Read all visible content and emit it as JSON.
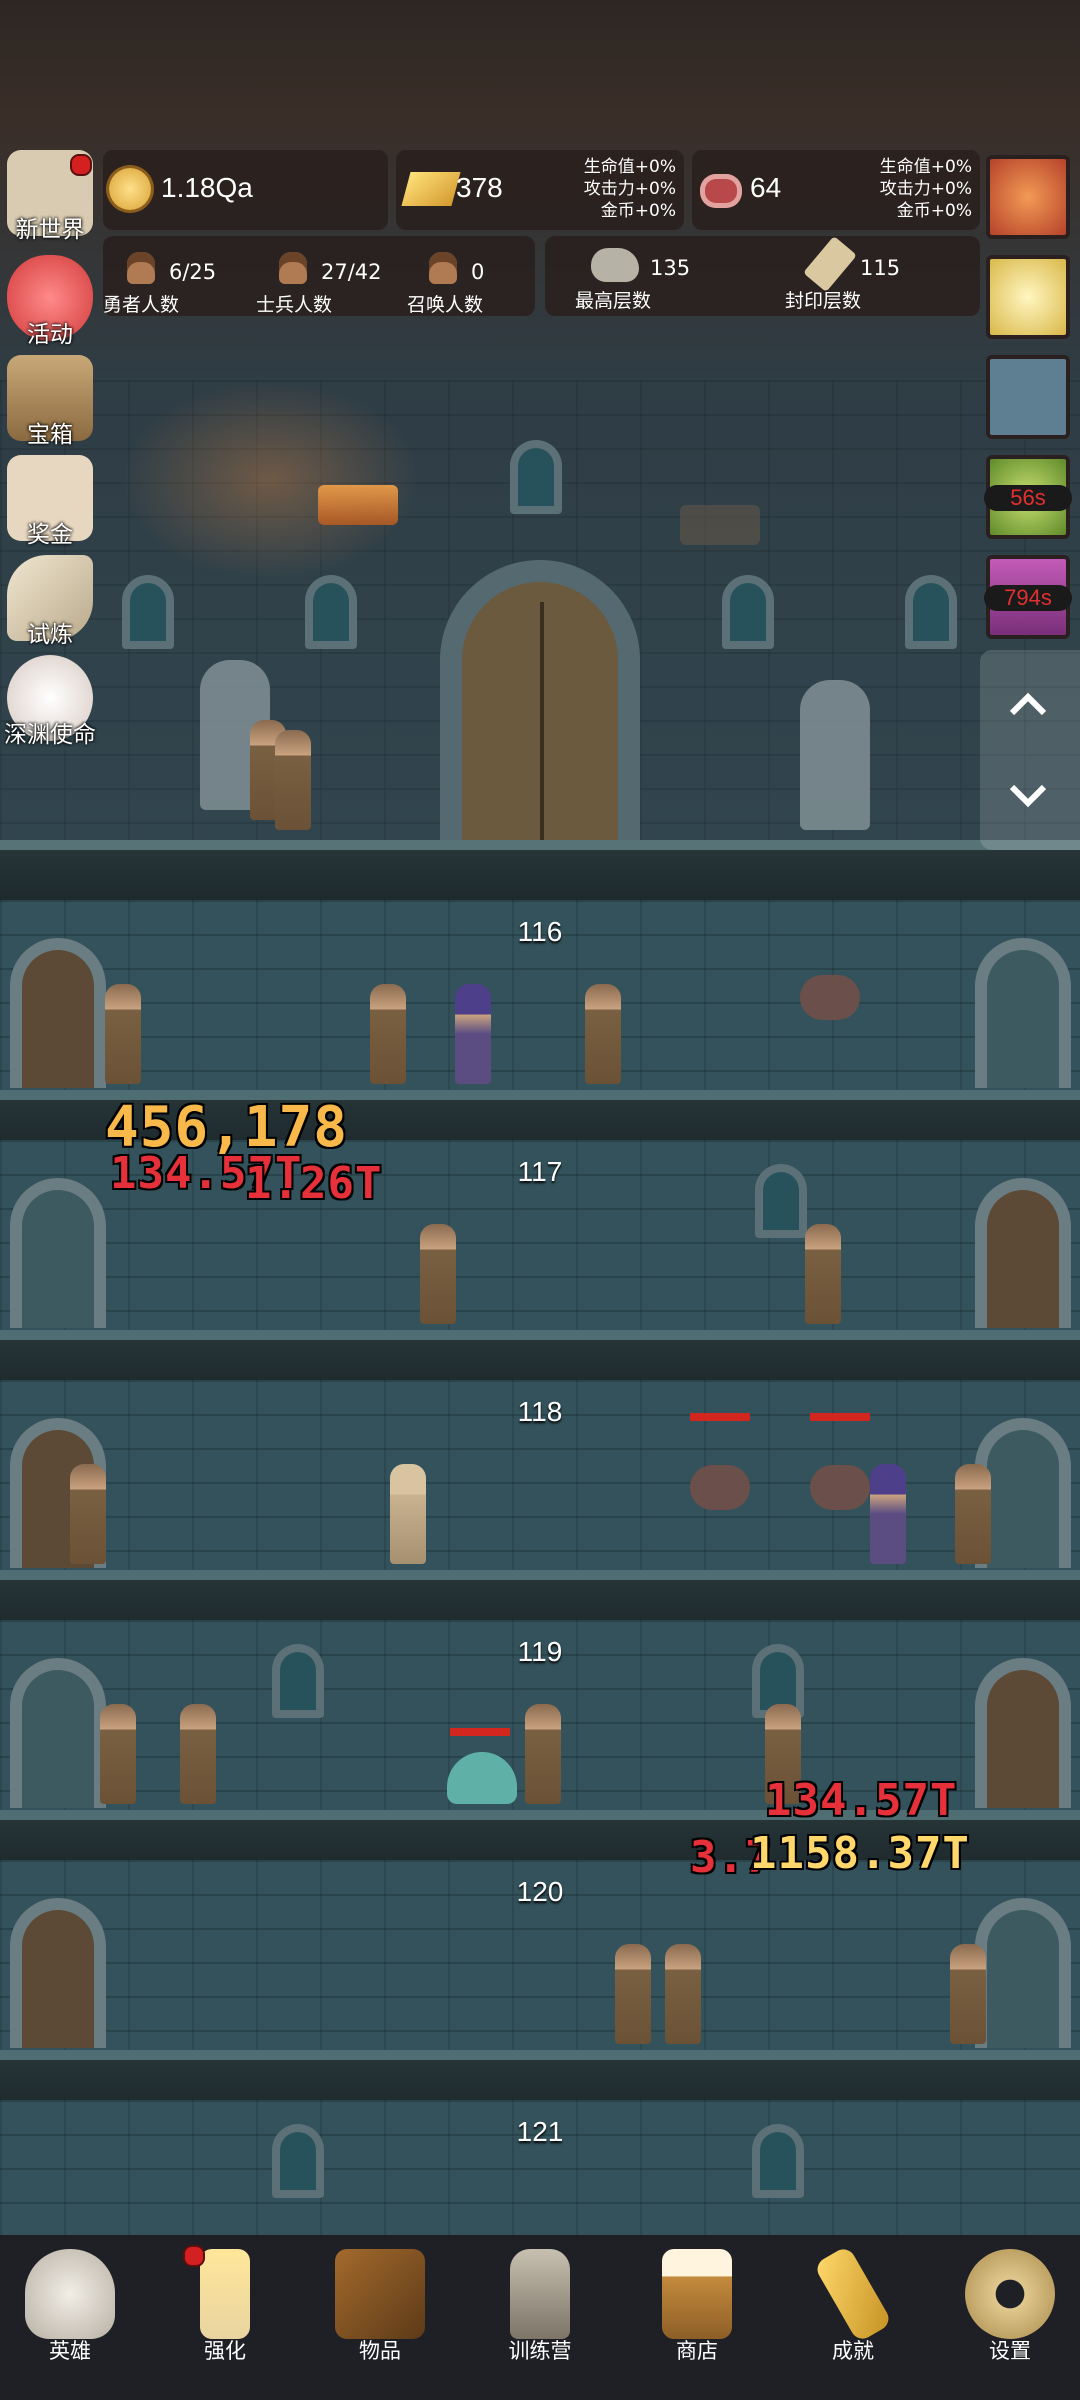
{
  "hud": {
    "coins": "1.18Qa",
    "gold_bars": "378",
    "gold_bonus": [
      "生命值+0%",
      "攻击力+0%",
      "金币+0%"
    ],
    "meat": "64",
    "meat_bonus": [
      "生命值+0%",
      "攻击力+0%",
      "金币+0%"
    ],
    "hero_count": {
      "value": "6/25",
      "label": "勇者人数"
    },
    "soldier_count": {
      "value": "27/42",
      "label": "士兵人数"
    },
    "summon_count": {
      "value": "0",
      "label": "召唤人数"
    },
    "max_floor": {
      "value": "135",
      "label": "最高层数"
    },
    "sealed_floor": {
      "value": "115",
      "label": "封印层数"
    }
  },
  "left_menu": [
    {
      "label": "新世界",
      "icon": "map-icon",
      "badge": true
    },
    {
      "label": "活动",
      "icon": "heart-icon",
      "badge": false
    },
    {
      "label": "宝箱",
      "icon": "chest-icon",
      "badge": false
    },
    {
      "label": "奖金",
      "icon": "envelope-icon",
      "badge": false
    },
    {
      "label": "试炼",
      "icon": "feather-icon",
      "badge": false
    },
    {
      "label": "深渊使命",
      "icon": "orb-icon",
      "badge": false
    }
  ],
  "right_menu": [
    {
      "icon": "apple-icon",
      "timer": ""
    },
    {
      "icon": "candle-icon",
      "timer": ""
    },
    {
      "icon": "scroll-bag-icon",
      "timer": ""
    },
    {
      "icon": "green-orb-icon",
      "timer": "56s"
    },
    {
      "icon": "purple-chest-icon",
      "timer": "794s"
    }
  ],
  "floors": [
    "116",
    "117",
    "118",
    "119",
    "120",
    "121"
  ],
  "damage_texts": [
    {
      "text": "456,178",
      "style": "gold"
    },
    {
      "text": "134.57T",
      "style": "red"
    },
    {
      "text": "1.26T",
      "style": "red"
    },
    {
      "text": "134.57T",
      "style": "red"
    },
    {
      "text": "3.7",
      "style": "red"
    },
    {
      "text": "1158.37T",
      "style": "red"
    }
  ],
  "nav": [
    {
      "label": "英雄",
      "icon": "skull-icon",
      "badge": false
    },
    {
      "label": "强化",
      "icon": "candle-icon",
      "badge": true
    },
    {
      "label": "物品",
      "icon": "book-icon",
      "badge": false
    },
    {
      "label": "训练营",
      "icon": "lantern-icon",
      "badge": false
    },
    {
      "label": "商店",
      "icon": "mug-icon",
      "badge": false
    },
    {
      "label": "成就",
      "icon": "key-icon",
      "badge": false
    },
    {
      "label": "设置",
      "icon": "gear-icon",
      "badge": false
    }
  ],
  "colors": {
    "damage_gold": "#f8b84a",
    "damage_red": "#e6303a",
    "hp_bar": "#d3261f"
  }
}
